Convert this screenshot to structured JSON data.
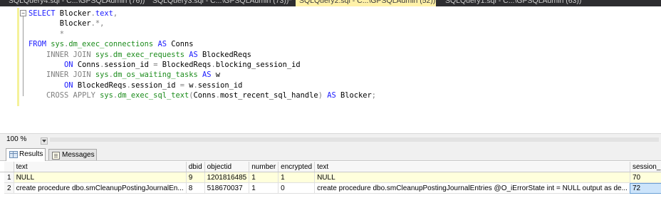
{
  "tabs": [
    {
      "label": "SQLQuery4.sql - C...\\GPSQLAdmin (76))",
      "active": false
    },
    {
      "label": "SQLQuery3.sql - C...\\GPSQLAdmin (73))*",
      "active": false
    },
    {
      "label": "SQLQuery2.sql - C...\\GPSQLAdmin (52))*",
      "active": true
    },
    {
      "label": "SQLQuery1.sql - C...\\GPSQLAdmin (63))",
      "active": false
    }
  ],
  "editor": {
    "collapse_glyph": "−",
    "lines": [
      [
        {
          "t": "SELECT ",
          "c": "kw"
        },
        {
          "t": "Blocker",
          "c": ""
        },
        {
          "t": ".",
          "c": "gray"
        },
        {
          "t": "text",
          "c": "kw"
        },
        {
          "t": ",",
          "c": "gray"
        }
      ],
      [
        {
          "t": "       Blocker",
          "c": ""
        },
        {
          "t": ".*,",
          "c": "gray"
        }
      ],
      [
        {
          "t": "       *",
          "c": "gray"
        }
      ],
      [
        {
          "t": "FROM ",
          "c": "kw"
        },
        {
          "t": "sys",
          "c": "sys"
        },
        {
          "t": ".",
          "c": "gray"
        },
        {
          "t": "dm_exec_connections",
          "c": "sys"
        },
        {
          "t": " AS ",
          "c": "kw"
        },
        {
          "t": "Conns",
          "c": ""
        }
      ],
      [
        {
          "t": "    INNER JOIN ",
          "c": "gray"
        },
        {
          "t": "sys",
          "c": "sys"
        },
        {
          "t": ".",
          "c": "gray"
        },
        {
          "t": "dm_exec_requests",
          "c": "sys"
        },
        {
          "t": " AS ",
          "c": "kw"
        },
        {
          "t": "BlockedReqs",
          "c": ""
        }
      ],
      [
        {
          "t": "        ON ",
          "c": "kw"
        },
        {
          "t": "Conns",
          "c": ""
        },
        {
          "t": ".",
          "c": "gray"
        },
        {
          "t": "session_id ",
          "c": ""
        },
        {
          "t": "= ",
          "c": "gray"
        },
        {
          "t": "BlockedReqs",
          "c": ""
        },
        {
          "t": ".",
          "c": "gray"
        },
        {
          "t": "blocking_session_id",
          "c": ""
        }
      ],
      [
        {
          "t": "    INNER JOIN ",
          "c": "gray"
        },
        {
          "t": "sys",
          "c": "sys"
        },
        {
          "t": ".",
          "c": "gray"
        },
        {
          "t": "dm_os_waiting_tasks",
          "c": "sys"
        },
        {
          "t": " AS ",
          "c": "kw"
        },
        {
          "t": "w",
          "c": ""
        }
      ],
      [
        {
          "t": "        ON ",
          "c": "kw"
        },
        {
          "t": "BlockedReqs",
          "c": ""
        },
        {
          "t": ".",
          "c": "gray"
        },
        {
          "t": "session_id ",
          "c": ""
        },
        {
          "t": "= ",
          "c": "gray"
        },
        {
          "t": "w",
          "c": ""
        },
        {
          "t": ".",
          "c": "gray"
        },
        {
          "t": "session_id",
          "c": ""
        }
      ],
      [
        {
          "t": "    CROSS APPLY ",
          "c": "gray"
        },
        {
          "t": "sys",
          "c": "sys"
        },
        {
          "t": ".",
          "c": "gray"
        },
        {
          "t": "dm_exec_sql_text",
          "c": "sys"
        },
        {
          "t": "(",
          "c": "gray"
        },
        {
          "t": "Conns",
          "c": ""
        },
        {
          "t": ".",
          "c": "gray"
        },
        {
          "t": "most_recent_sql_handle",
          "c": ""
        },
        {
          "t": ") ",
          "c": "gray"
        },
        {
          "t": "AS ",
          "c": "kw"
        },
        {
          "t": "Blocker",
          "c": ""
        },
        {
          "t": ";",
          "c": "gray"
        }
      ]
    ]
  },
  "zoom": "100 %",
  "results_tabs": [
    {
      "label": "Results",
      "active": true
    },
    {
      "label": "Messages",
      "active": false
    }
  ],
  "grid": {
    "columns": [
      "",
      "text",
      "dbid",
      "objectid",
      "number",
      "encrypted",
      "text",
      "session_id"
    ],
    "rows": [
      [
        "1",
        "NULL",
        "9",
        "1201816485",
        "1",
        "1",
        "NULL",
        "70"
      ],
      [
        "2",
        "create procedure dbo.smCleanupPostingJournalEn...",
        "8",
        "518670037",
        "1",
        "0",
        "create procedure dbo.smCleanupPostingJournalEntries   @O_iErrorState int    = NULL   output as   de...",
        "72"
      ]
    ]
  },
  "colors": {
    "keyword": "#1a1aff",
    "system_object": "#1c8c1c",
    "operator": "#808080",
    "active_tab": "#fff1a8",
    "highlight_row": "#ffffdc",
    "selected_cell": "#cce4fb"
  }
}
